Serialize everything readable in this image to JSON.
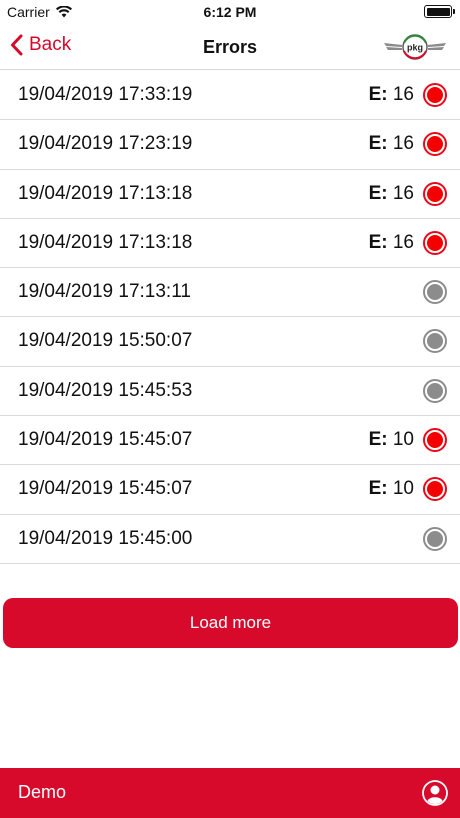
{
  "status_bar": {
    "carrier": "Carrier",
    "time": "6:12 PM"
  },
  "nav": {
    "back_label": "Back",
    "title": "Errors",
    "logo_text": "pkg"
  },
  "errors": [
    {
      "date": "19/04/2019 17:33:19",
      "prefix": "E:",
      "code": "16",
      "status": "error"
    },
    {
      "date": "19/04/2019 17:23:19",
      "prefix": "E:",
      "code": "16",
      "status": "error"
    },
    {
      "date": "19/04/2019 17:13:18",
      "prefix": "E:",
      "code": "16",
      "status": "error"
    },
    {
      "date": "19/04/2019 17:13:18",
      "prefix": "E:",
      "code": "16",
      "status": "error"
    },
    {
      "date": "19/04/2019 17:13:11",
      "prefix": "",
      "code": "",
      "status": "ok"
    },
    {
      "date": "19/04/2019 15:50:07",
      "prefix": "",
      "code": "",
      "status": "ok"
    },
    {
      "date": "19/04/2019 15:45:53",
      "prefix": "",
      "code": "",
      "status": "ok"
    },
    {
      "date": "19/04/2019 15:45:07",
      "prefix": "E:",
      "code": "10",
      "status": "error"
    },
    {
      "date": "19/04/2019 15:45:07",
      "prefix": "E:",
      "code": "10",
      "status": "error"
    },
    {
      "date": "19/04/2019 15:45:00",
      "prefix": "",
      "code": "",
      "status": "ok"
    }
  ],
  "load_more_label": "Load more",
  "bottom_bar": {
    "label": "Demo"
  },
  "colors": {
    "accent": "#d80a2c",
    "error_dot": "#f50000",
    "ok_dot": "#8c8c8c"
  }
}
